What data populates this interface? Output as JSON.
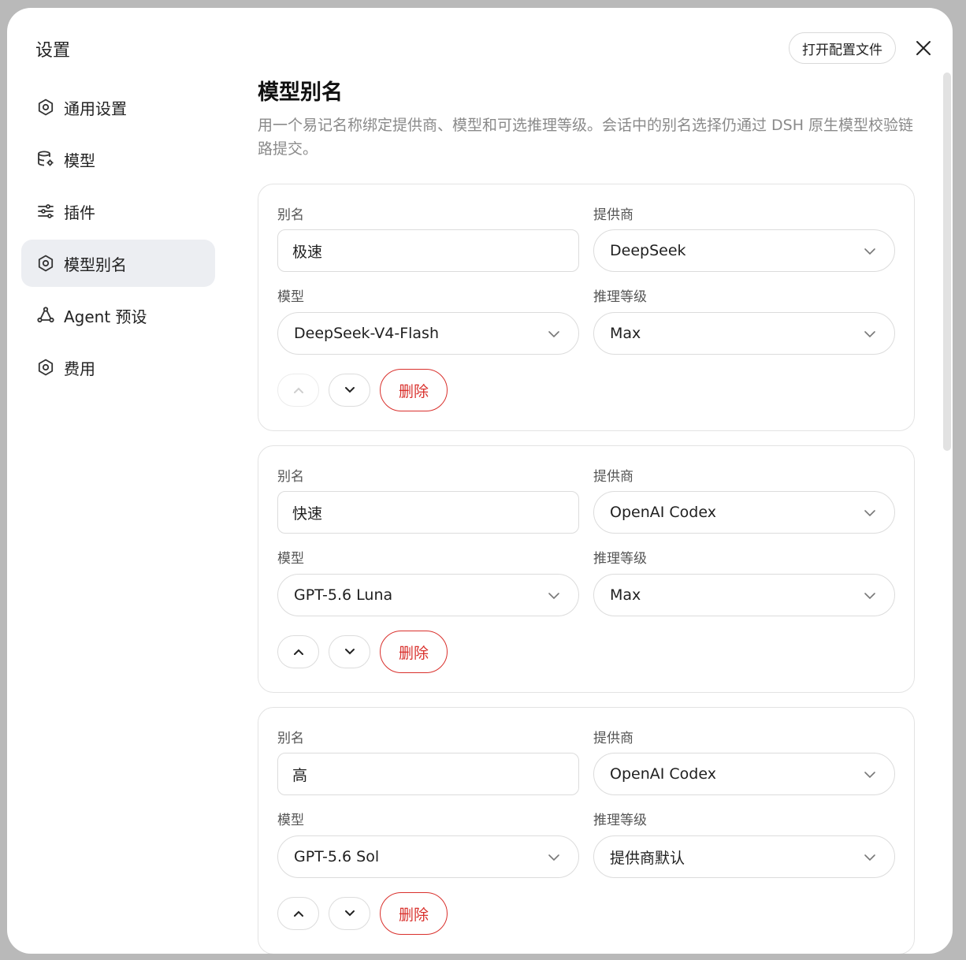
{
  "sidebar": {
    "title": "设置",
    "items": [
      {
        "label": "通用设置",
        "icon": "gear-icon",
        "active": false
      },
      {
        "label": "模型",
        "icon": "database-gear-icon",
        "active": false
      },
      {
        "label": "插件",
        "icon": "sliders-icon",
        "active": false
      },
      {
        "label": "模型别名",
        "icon": "gear-icon",
        "active": true
      },
      {
        "label": "Agent 预设",
        "icon": "agent-nodes-icon",
        "active": false
      },
      {
        "label": "费用",
        "icon": "gear-icon",
        "active": false
      }
    ]
  },
  "header": {
    "open_config_label": "打开配置文件",
    "close_icon": "close-icon"
  },
  "main": {
    "title": "模型别名",
    "description": "用一个易记名称绑定提供商、模型和可选推理等级。会话中的别名选择仍通过 DSH 原生模型校验链路提交。",
    "labels": {
      "alias": "别名",
      "provider": "提供商",
      "model": "模型",
      "reasoning": "推理等级",
      "delete": "删除"
    },
    "aliases": [
      {
        "alias": "极速",
        "provider": "DeepSeek",
        "model": "DeepSeek-V4-Flash",
        "reasoning": "Max",
        "move_up_enabled": false
      },
      {
        "alias": "快速",
        "provider": "OpenAI Codex",
        "model": "GPT-5.6 Luna",
        "reasoning": "Max",
        "move_up_enabled": true
      },
      {
        "alias": "高",
        "provider": "OpenAI Codex",
        "model": "GPT-5.6 Sol",
        "reasoning": "提供商默认",
        "move_up_enabled": true
      }
    ]
  },
  "colors": {
    "accent_danger": "#d9302c",
    "active_nav_bg": "#eceef2",
    "muted_text": "#8a8a8a"
  }
}
